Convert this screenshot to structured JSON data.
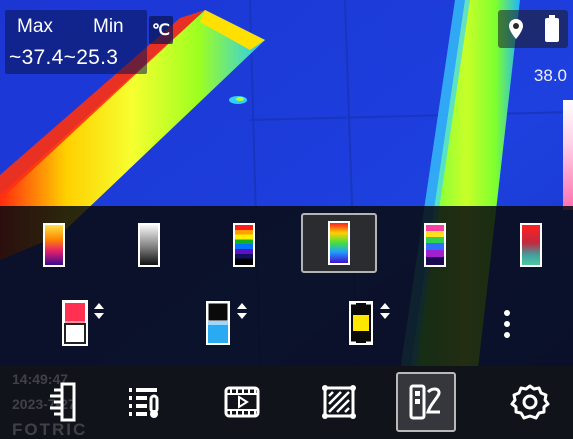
{
  "temperature": {
    "max_label": "Max",
    "min_label": "Min",
    "range": "~37.4~25.3",
    "unit": "℃"
  },
  "scale": {
    "max_value": "38.0"
  },
  "status": {
    "icons": [
      "location-pin-icon",
      "battery-icon"
    ]
  },
  "palettes": [
    {
      "name": "ironbow",
      "selected": false
    },
    {
      "name": "whitehot",
      "selected": false
    },
    {
      "name": "rainbow-hc",
      "selected": false
    },
    {
      "name": "rainbow",
      "selected": true
    },
    {
      "name": "lava",
      "selected": false
    },
    {
      "name": "red-green",
      "selected": false
    }
  ],
  "tools": [
    "level-span-high-icon",
    "level-span-low-icon",
    "isotherm-icon",
    "more-icon"
  ],
  "overlay": {
    "time": "14:49:47",
    "date": "2023-7-27",
    "brand": "FOTRIC"
  },
  "nav": [
    {
      "icon": "ruler-icon",
      "active": false
    },
    {
      "icon": "measure-list-icon",
      "active": false
    },
    {
      "icon": "video-icon",
      "active": false
    },
    {
      "icon": "area-crop-icon",
      "active": false
    },
    {
      "icon": "palette-edit-icon",
      "active": true
    },
    {
      "icon": "settings-gear-icon",
      "active": false
    }
  ],
  "colors": {
    "panel_bg": "#08090e",
    "selected_border": "#b4b4b4",
    "thermal_blue": "#1e3cd8"
  }
}
